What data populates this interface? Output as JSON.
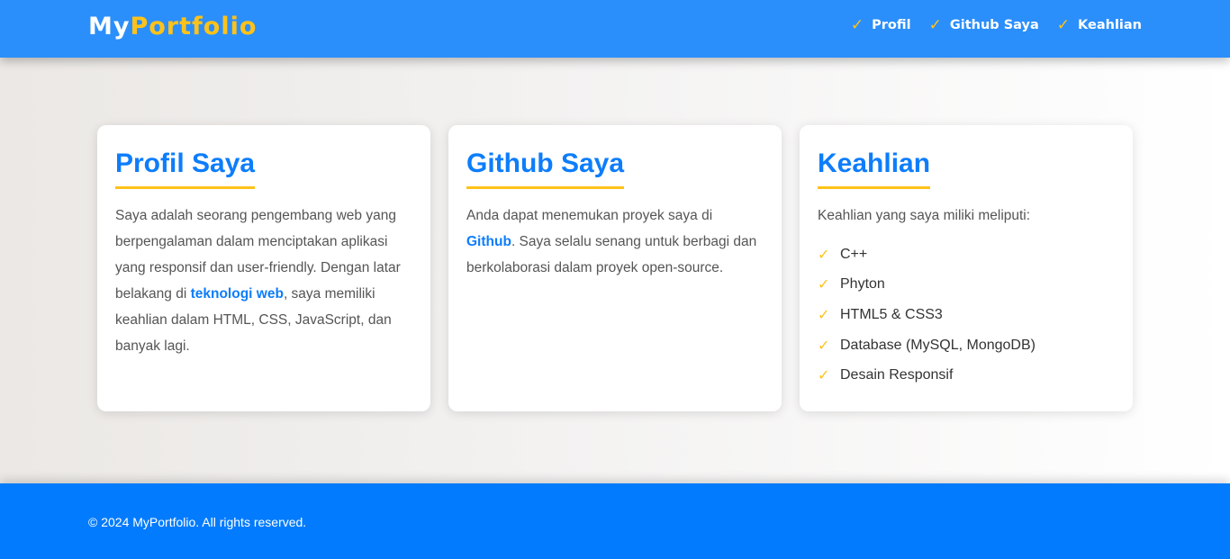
{
  "header": {
    "logo_my": "My",
    "logo_portfolio": "Portfolio",
    "nav": [
      {
        "label": "Profil",
        "icon": "check-icon"
      },
      {
        "label": "Github Saya",
        "icon": "check-icon"
      },
      {
        "label": "Keahlian",
        "icon": "check-icon"
      }
    ]
  },
  "check_glyph": "✓",
  "profil": {
    "title": "Profil Saya",
    "text_before": "Saya adalah seorang pengembang web yang berpengalaman dalam menciptakan aplikasi yang responsif dan user-friendly. Dengan latar belakang di ",
    "link": "teknologi web",
    "text_after": ", saya memiliki keahlian dalam HTML, CSS, JavaScript, dan banyak lagi."
  },
  "github": {
    "title": "Github Saya",
    "text_before": "Anda dapat menemukan proyek saya di ",
    "link": "Github",
    "text_after": ". Saya selalu senang untuk berbagi dan berkolaborasi dalam proyek open-source."
  },
  "keahlian": {
    "title": "Keahlian",
    "intro": "Keahlian yang saya miliki meliputi:",
    "items": [
      "C++",
      "Phyton",
      "HTML5 & CSS3",
      "Database (MySQL, MongoDB)",
      "Desain Responsif"
    ]
  },
  "footer": {
    "text": "© 2024 MyPortfolio. All rights reserved."
  },
  "colors": {
    "header_bg": "#2b8ffb",
    "footer_bg": "#037bfe",
    "accent": "#ffc21a",
    "title_blue": "#0d7dfb"
  }
}
